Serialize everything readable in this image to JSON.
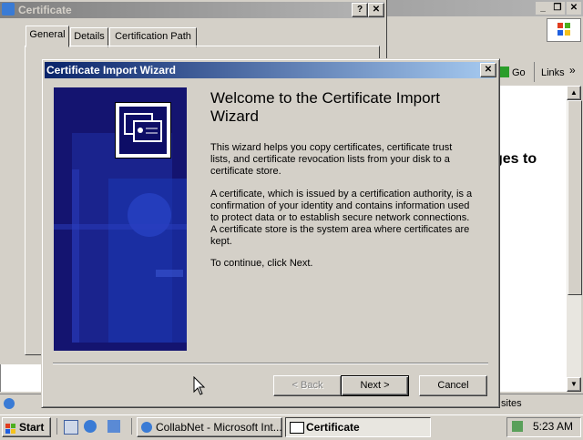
{
  "ie": {
    "menu_partial": "F",
    "address_partial": "Ac",
    "go_label": "Go",
    "links_label": "Links",
    "chevron": "»",
    "page_text_partial": "ges to",
    "page_text_partial2": "o",
    "status_partial": "sites"
  },
  "cert_window": {
    "title": "Certificate",
    "help_btn": "?",
    "close_btn": "✕",
    "tabs": [
      {
        "label": "General"
      },
      {
        "label": "Details"
      },
      {
        "label": "Certification Path"
      }
    ]
  },
  "wizard": {
    "title": "Certificate Import Wizard",
    "close_btn": "✕",
    "heading": "Welcome to the Certificate Import Wizard",
    "para1": "This wizard helps you copy certificates, certificate trust lists, and certificate revocation lists from your disk to a certificate store.",
    "para2": "A certificate, which is issued by a certification authority, is a confirmation of your identity and contains information used to protect data or to establish secure network connections. A certificate store is the system area where certificates are kept.",
    "para3": "To continue, click Next.",
    "back_label": "< Back",
    "next_label": "Next >",
    "cancel_label": "Cancel"
  },
  "taskbar": {
    "start_label": "Start",
    "tasks": [
      {
        "label": "CollabNet - Microsoft Int..."
      },
      {
        "label": "Certificate"
      }
    ],
    "clock": "5:23 AM"
  },
  "colors": {
    "title_active": "#0a246a",
    "title_inactive": "#808080",
    "face": "#d4d0c8",
    "banner": "#1a1a7a"
  }
}
